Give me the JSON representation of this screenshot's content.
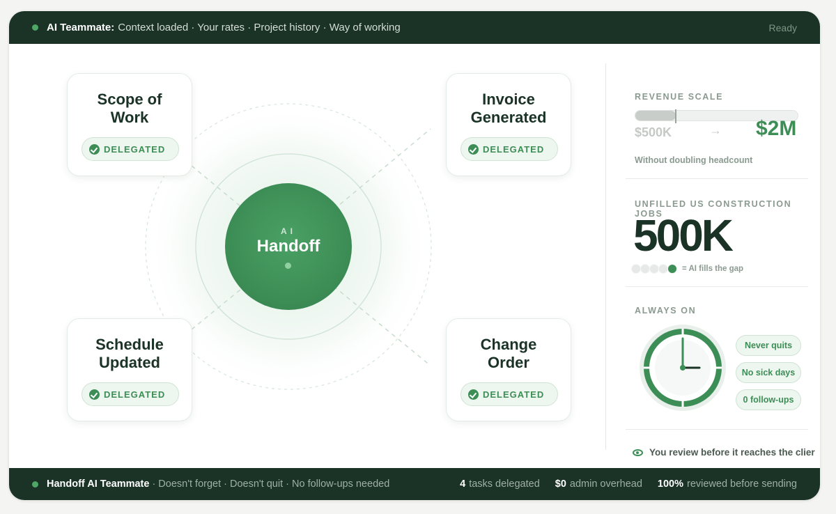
{
  "header": {
    "lead": "AI Teammate:",
    "context": "Context loaded · Your rates · Project history · Way of working",
    "status": "Ready"
  },
  "hub": {
    "center_kicker": "AI",
    "center_title": "Handoff",
    "cards": [
      {
        "title_line1": "Scope of",
        "title_line2": "Work",
        "badge": "DELEGATED"
      },
      {
        "title_line1": "Invoice",
        "title_line2": "Generated",
        "badge": "DELEGATED"
      },
      {
        "title_line1": "Schedule",
        "title_line2": "Updated",
        "badge": "DELEGATED"
      },
      {
        "title_line1": "Change",
        "title_line2": "Order",
        "badge": "DELEGATED"
      }
    ]
  },
  "revenue": {
    "label": "REVENUE SCALE",
    "low": "$500K",
    "arrow": "→",
    "high": "$2M",
    "note": "Without doubling headcount",
    "progress_fraction": 0.25
  },
  "jobs": {
    "label": "UNFILLED US CONSTRUCTION JOBS",
    "value": "500K",
    "dots_total": 5,
    "dots_filled": 1,
    "note": "= AI fills the gap"
  },
  "always_on": {
    "label": "ALWAYS ON",
    "pills": [
      "Never quits",
      "No sick days",
      "0 follow-ups"
    ]
  },
  "review": {
    "text": "You review before it reaches the clier"
  },
  "footer": {
    "lead": "Handoff AI Teammate",
    "tagline": "· Doesn't forget · Doesn't quit · No follow-ups needed",
    "stats": [
      {
        "value": "4",
        "label": "tasks delegated"
      },
      {
        "value": "$0",
        "label": "admin overhead"
      },
      {
        "value": "100%",
        "label": "reviewed before sending"
      }
    ]
  },
  "colors": {
    "dark_green": "#1a3326",
    "accent_green": "#3d8e56",
    "light_green_bg": "#eef6f0"
  }
}
